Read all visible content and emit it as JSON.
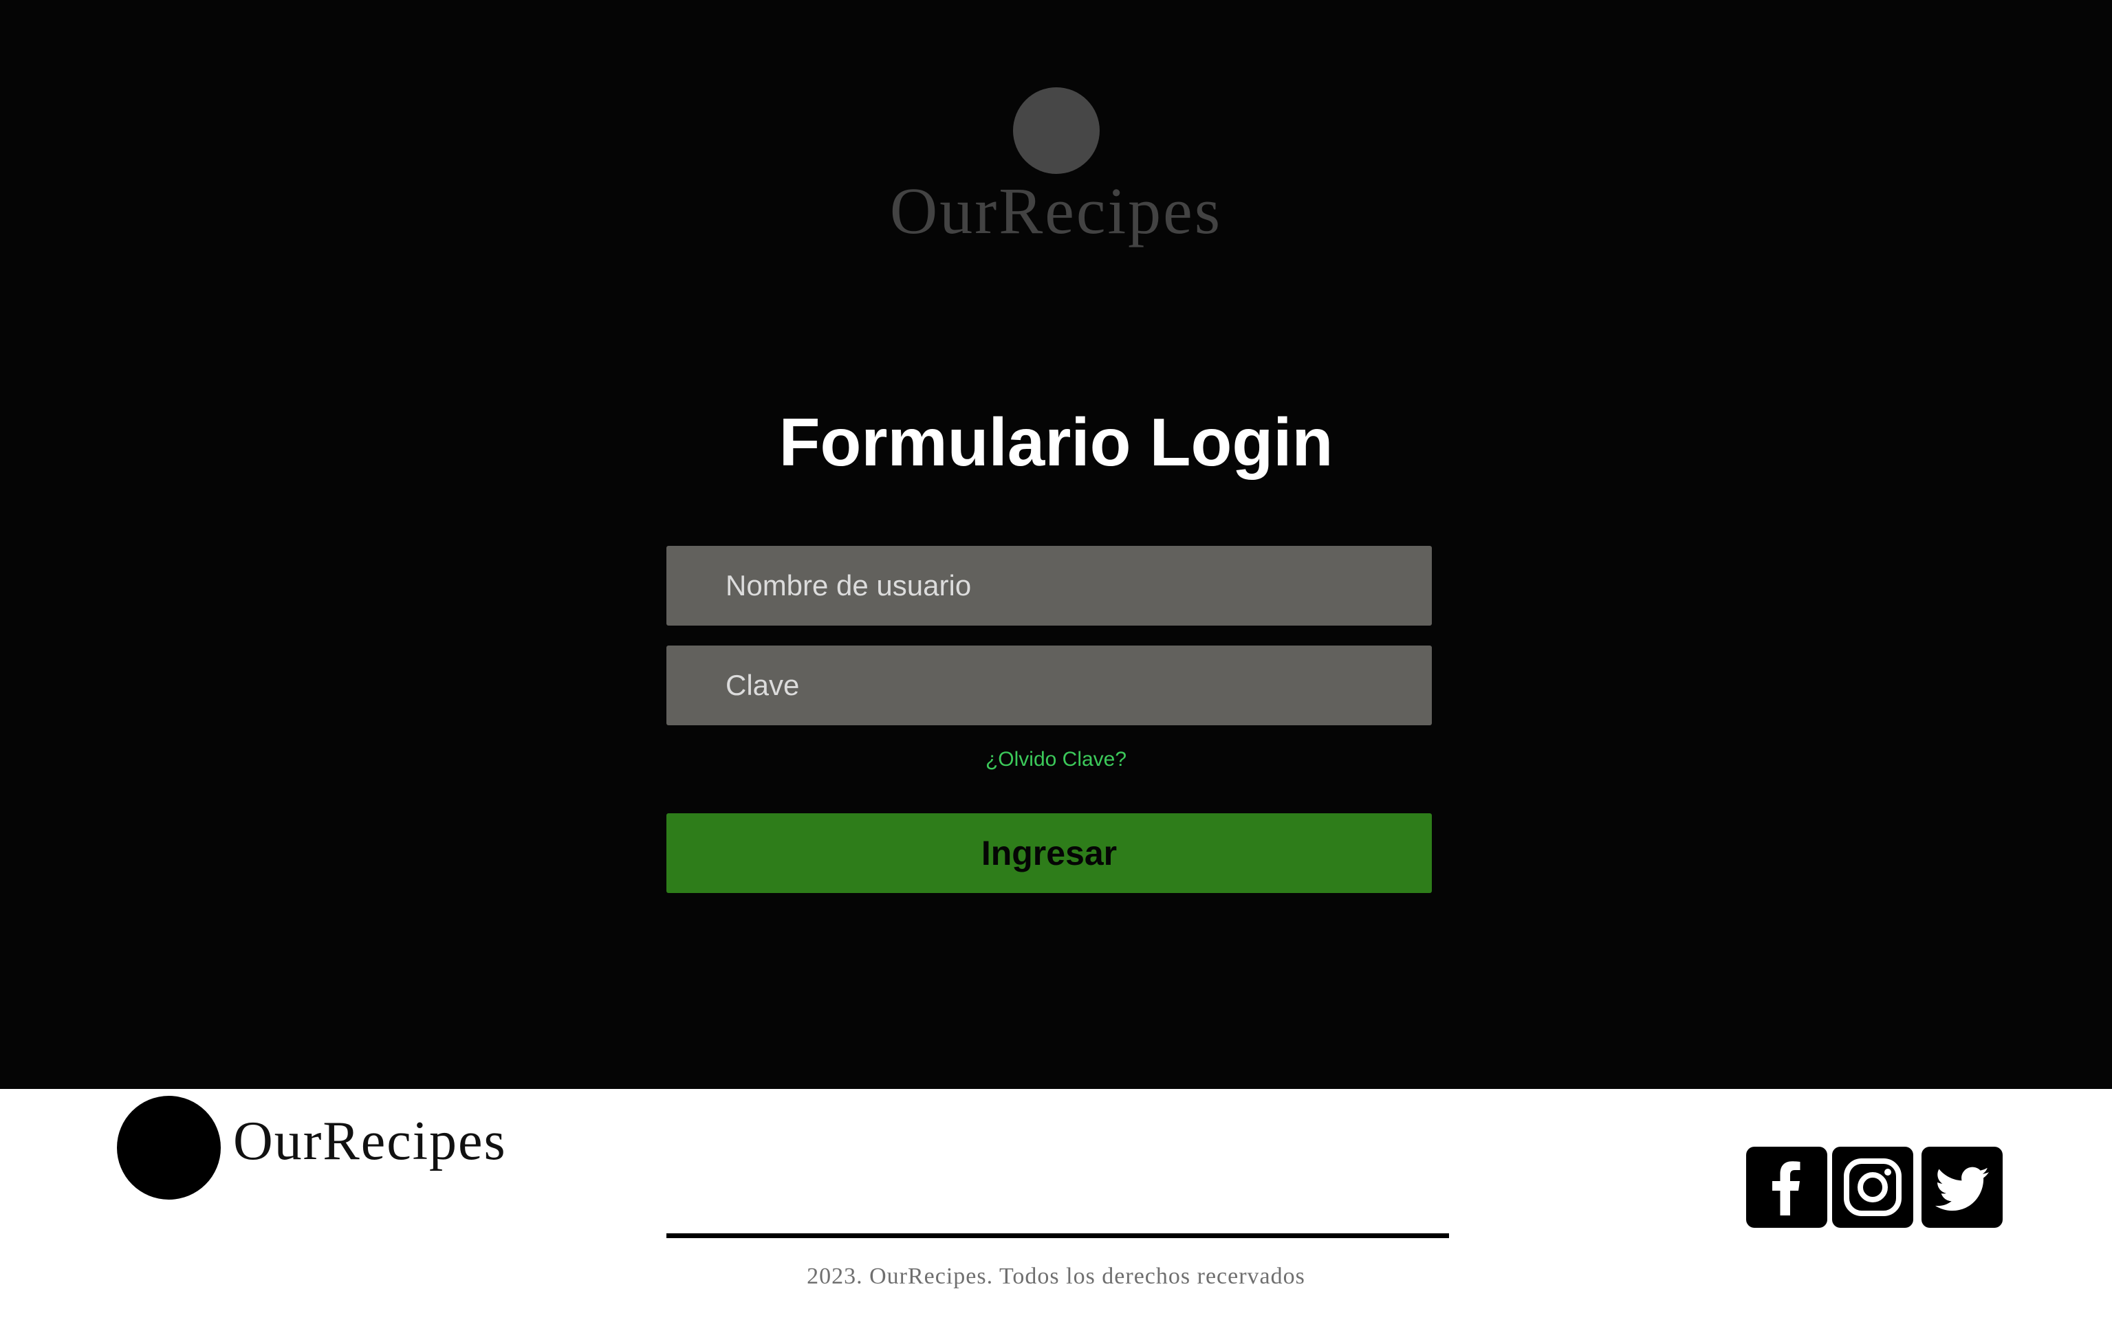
{
  "header": {
    "logo_text": "OurRecipes"
  },
  "login_form": {
    "title": "Formulario Login",
    "username_placeholder": "Nombre de usuario",
    "password_placeholder": "Clave",
    "forgot_link": "¿Olvido Clave?",
    "submit_label": "Ingresar"
  },
  "footer": {
    "logo_text": "OurRecipes",
    "social_icons": [
      "facebook-icon",
      "instagram-icon",
      "twitter-icon"
    ],
    "copyright": "2023. OurRecipes. Todos los derechos recervados"
  },
  "colors": {
    "background_dark": "#050505",
    "input_background": "#62615d",
    "button_green": "#2e7d1a",
    "link_green": "#3cc95a",
    "footer_background": "#ffffff"
  }
}
